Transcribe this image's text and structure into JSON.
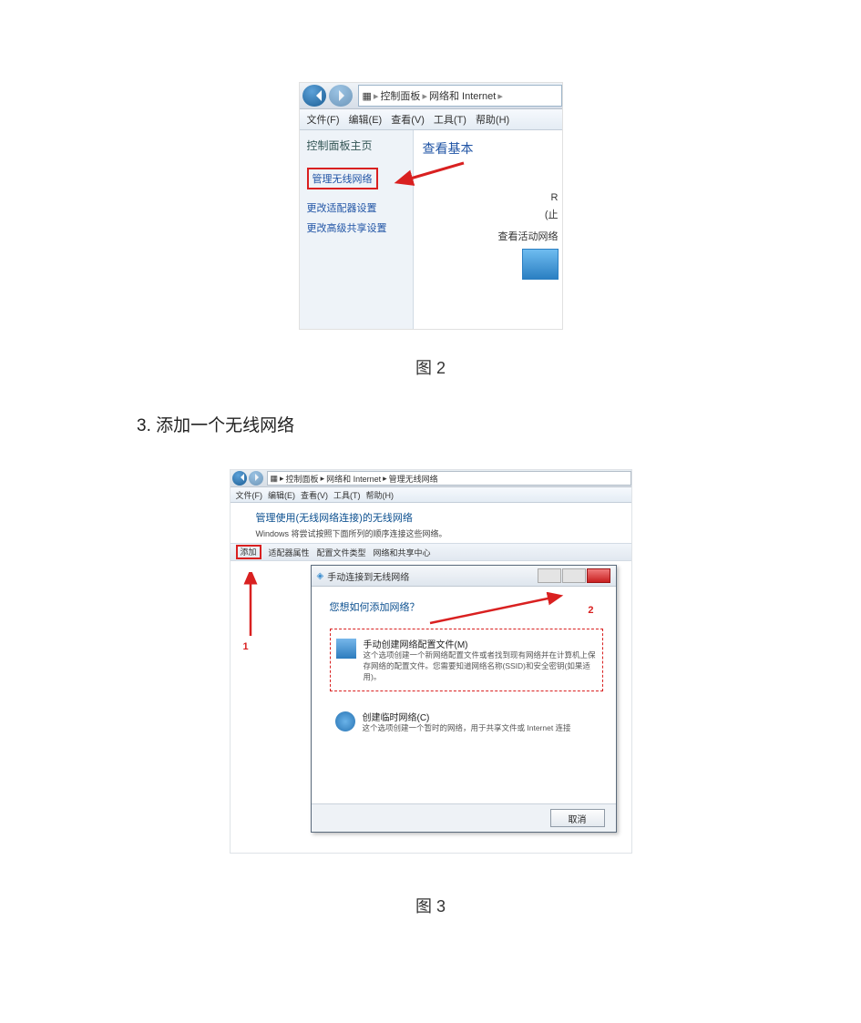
{
  "captions": {
    "fig2": "图 2",
    "fig3": "图 3"
  },
  "step3": "3.  添加一个无线网络",
  "fig2": {
    "crumbs": {
      "icon": "⬚",
      "a": "控制面板",
      "b": "网络和 Internet"
    },
    "menu": [
      "文件(F)",
      "编辑(E)",
      "查看(V)",
      "工具(T)",
      "帮助(H)"
    ],
    "sidebar": {
      "header": "控制面板主页",
      "manage": "管理无线网络",
      "adapter": "更改适配器设置",
      "sharing": "更改高级共享设置"
    },
    "content": {
      "title": "查看基本",
      "line1": "R",
      "line2": "(止",
      "line3": "查看活动网络"
    }
  },
  "fig3": {
    "crumbs": {
      "a": "控制面板",
      "b": "网络和 Internet",
      "c": "管理无线网络"
    },
    "menu": [
      "文件(F)",
      "编辑(E)",
      "查看(V)",
      "工具(T)",
      "帮助(H)"
    ],
    "header": {
      "title": "管理使用(无线网络连接)的无线网络",
      "sub": "Windows 将尝试按照下面所列的顺序连接这些网络。"
    },
    "toolbar": {
      "add": "添加",
      "adapter": "适配器属性",
      "profile": "配置文件类型",
      "center": "网络和共享中心"
    },
    "labels": {
      "one": "1",
      "two": "2"
    },
    "dialog": {
      "title": "手动连接到无线网络",
      "question": "您想如何添加网络？",
      "opt1_title": "手动创建网络配置文件(M)",
      "opt1_desc": "这个选项创建一个新网络配置文件或者找到现有网络并在计算机上保存网络的配置文件。您需要知道网络名称(SSID)和安全密钥(如果适用)。",
      "opt2_title": "创建临时网络(C)",
      "opt2_desc": "这个选项创建一个暂时的网络，用于共享文件或 Internet 连接",
      "cancel": "取消"
    }
  }
}
